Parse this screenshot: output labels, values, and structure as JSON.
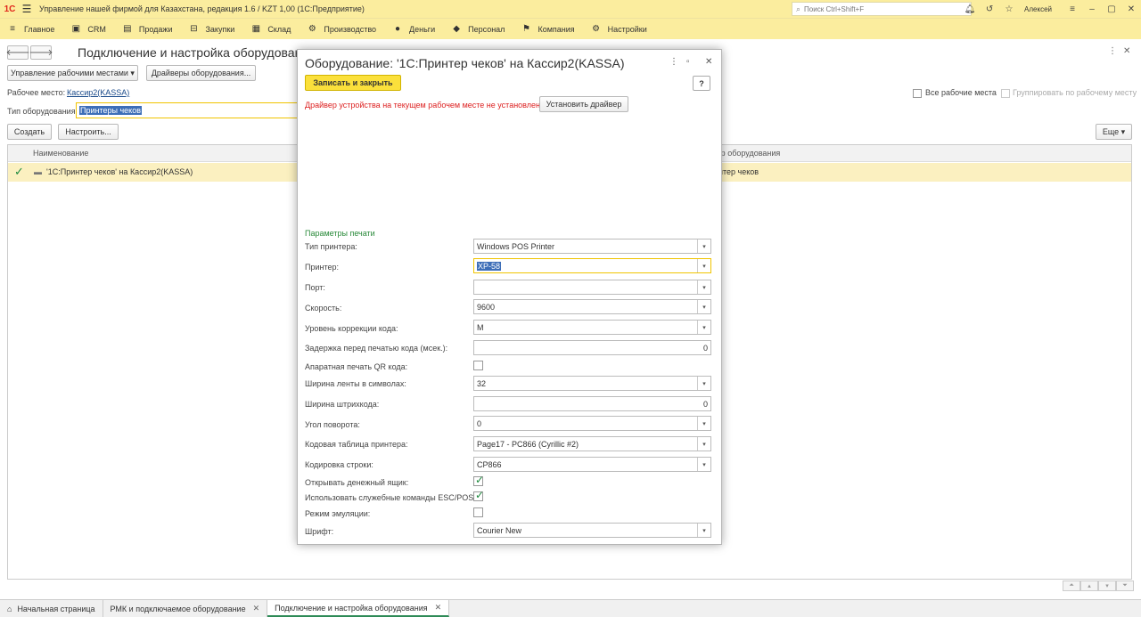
{
  "titlebar": {
    "logo": "1С",
    "title": "Управление нашей фирмой для Казахстана, редакция 1.6 / KZT 1,00  (1С:Предприятие)",
    "search_placeholder": "Поиск Ctrl+Shift+F",
    "user": "Алексей"
  },
  "menu": [
    {
      "icon": "≡",
      "label": "Главное"
    },
    {
      "icon": "▣",
      "label": "CRM"
    },
    {
      "icon": "▤",
      "label": "Продажи"
    },
    {
      "icon": "⊟",
      "label": "Закупки"
    },
    {
      "icon": "▦",
      "label": "Склад"
    },
    {
      "icon": "⚙",
      "label": "Производство"
    },
    {
      "icon": "●",
      "label": "Деньги"
    },
    {
      "icon": "◆",
      "label": "Персонал"
    },
    {
      "icon": "⚑",
      "label": "Компания"
    },
    {
      "icon": "⚙",
      "label": "Настройки"
    }
  ],
  "form": {
    "title": "Подключение и настройка оборудования",
    "manage_workplaces": "Управление рабочими местами",
    "drivers": "Драйверы оборудования...",
    "workplace_label": "Рабочее место:",
    "workplace_value": "Кассир2(KASSA)",
    "equipment_type_label": "Тип оборудования:",
    "equipment_type_value": "Принтеры чеков",
    "create": "Создать",
    "configure": "Настроить...",
    "all_workplaces": "Все рабочие места",
    "group_by_workplace": "Группировать по рабочему месту",
    "more": "Еще",
    "col_name": "Наименование",
    "col_driver": "вер оборудования",
    "row_name": "'1С:Принтер чеков' на Кассир2(KASSA)",
    "row_driver": "рінтер чеков"
  },
  "modal": {
    "title": "Оборудование: '1С:Принтер чеков' на Кассир2(KASSA)",
    "save_close": "Записать и закрыть",
    "help": "?",
    "warning": "Драйвер устройства на текущем рабочем месте не установлен.",
    "install_driver": "Установить драйвер",
    "section_title": "Параметры печати",
    "params": {
      "printer_type_label": "Тип принтера:",
      "printer_type": "Windows POS Printer",
      "printer_label": "Принтер:",
      "printer": "XP-58",
      "port_label": "Порт:",
      "port": "",
      "speed_label": "Скорость:",
      "speed": "9600",
      "correction_label": "Уровень коррекции кода:",
      "correction": "M",
      "delay_label": "Задержка перед печатью кода (мсек.):",
      "delay": "0",
      "qr_label": "Апаратная печать QR кода:",
      "tape_width_label": "Ширина ленты в символах:",
      "tape_width": "32",
      "barcode_width_label": "Ширина штрихкода:",
      "barcode_width": "0",
      "rotation_label": "Угол поворота:",
      "rotation": "0",
      "codepage_label": "Кодовая таблица принтера:",
      "codepage": "Page17 - PC866 (Cyrillic #2)",
      "encoding_label": "Кодировка строки:",
      "encoding": "CP866",
      "cash_drawer_label": "Открывать денежный ящик:",
      "esc_pos_label": "Использовать служебные команды ESC/POS:",
      "emulation_label": "Режим эмуляции:",
      "font_label": "Шрифт:",
      "font": "Courier New"
    },
    "checked": {
      "qr": false,
      "cash_drawer": true,
      "esc_pos": true,
      "emulation": false
    }
  },
  "tabs": [
    {
      "label": "Начальная страница"
    },
    {
      "label": "РМК и подключаемое оборудование"
    },
    {
      "label": "Подключение и настройка оборудования"
    }
  ]
}
